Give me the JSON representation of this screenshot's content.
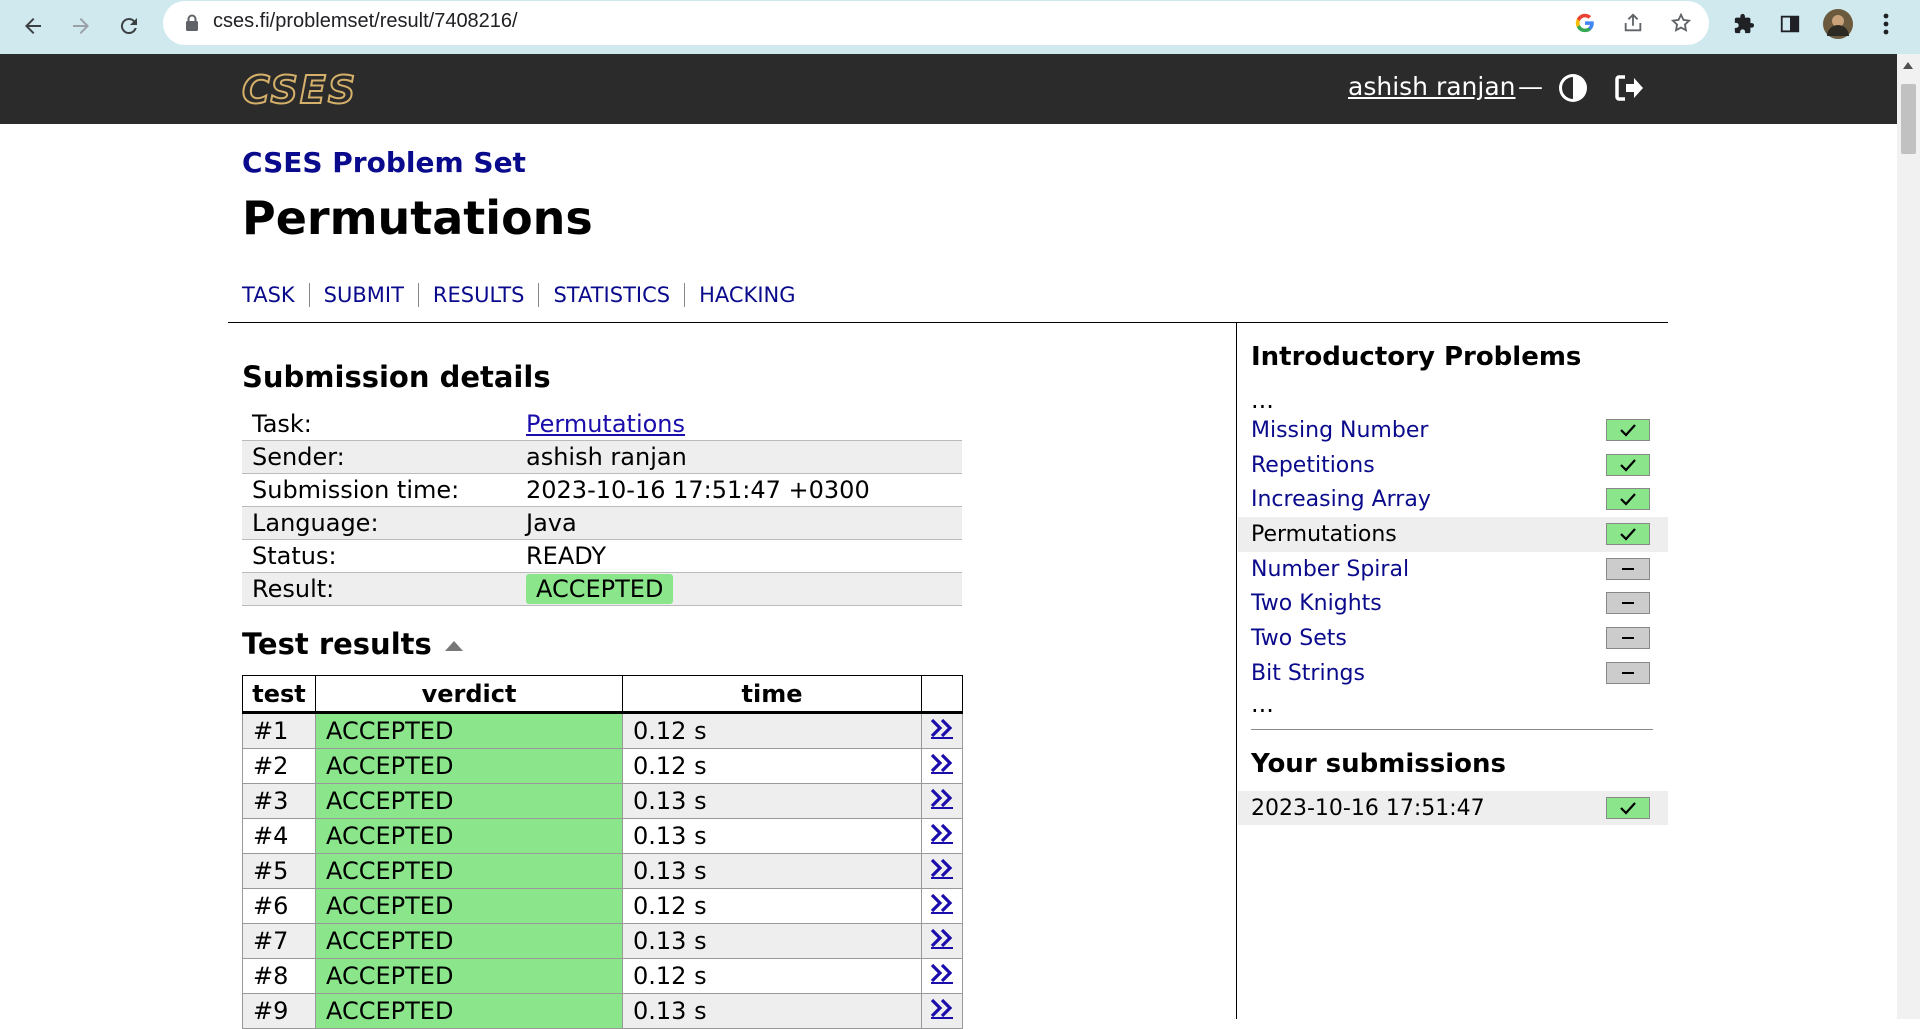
{
  "browser": {
    "url": "cses.fi/problemset/result/7408216/"
  },
  "header": {
    "logo_text": "CSES",
    "user": "ashish ranjan",
    "separator": "—"
  },
  "site_title": "CSES Problem Set",
  "page_title": "Permutations",
  "tabs": [
    "TASK",
    "SUBMIT",
    "RESULTS",
    "STATISTICS",
    "HACKING"
  ],
  "submission": {
    "heading": "Submission details",
    "rows": [
      {
        "key": "Task:",
        "value": "Permutations"
      },
      {
        "key": "Sender:",
        "value": "ashish ranjan"
      },
      {
        "key": "Submission time:",
        "value": "2023-10-16 17:51:47 +0300"
      },
      {
        "key": "Language:",
        "value": "Java"
      },
      {
        "key": "Status:",
        "value": "READY"
      },
      {
        "key": "Result:",
        "value": "ACCEPTED"
      }
    ]
  },
  "tests": {
    "heading": "Test results",
    "columns": [
      "test",
      "verdict",
      "time"
    ],
    "rows": [
      {
        "test": "#1",
        "verdict": "ACCEPTED",
        "time": "0.12 s"
      },
      {
        "test": "#2",
        "verdict": "ACCEPTED",
        "time": "0.12 s"
      },
      {
        "test": "#3",
        "verdict": "ACCEPTED",
        "time": "0.13 s"
      },
      {
        "test": "#4",
        "verdict": "ACCEPTED",
        "time": "0.13 s"
      },
      {
        "test": "#5",
        "verdict": "ACCEPTED",
        "time": "0.13 s"
      },
      {
        "test": "#6",
        "verdict": "ACCEPTED",
        "time": "0.12 s"
      },
      {
        "test": "#7",
        "verdict": "ACCEPTED",
        "time": "0.13 s"
      },
      {
        "test": "#8",
        "verdict": "ACCEPTED",
        "time": "0.12 s"
      },
      {
        "test": "#9",
        "verdict": "ACCEPTED",
        "time": "0.13 s"
      }
    ]
  },
  "sidebar": {
    "title": "Introductory Problems",
    "dots": "...",
    "items": [
      {
        "label": "Missing Number",
        "solved": true,
        "current": false
      },
      {
        "label": "Repetitions",
        "solved": true,
        "current": false
      },
      {
        "label": "Increasing Array",
        "solved": true,
        "current": false
      },
      {
        "label": "Permutations",
        "solved": true,
        "current": true
      },
      {
        "label": "Number Spiral",
        "solved": false,
        "current": false
      },
      {
        "label": "Two Knights",
        "solved": false,
        "current": false
      },
      {
        "label": "Two Sets",
        "solved": false,
        "current": false
      },
      {
        "label": "Bit Strings",
        "solved": false,
        "current": false
      }
    ],
    "submissions_title": "Your submissions",
    "submissions": [
      {
        "time": "2023-10-16 17:51:47",
        "accepted": true
      }
    ]
  },
  "colors": {
    "accent": "#0a0a8c",
    "accepted": "#8be68b",
    "header_bg": "#2b2b2b",
    "chrome_bg": "#cfe9ef"
  }
}
